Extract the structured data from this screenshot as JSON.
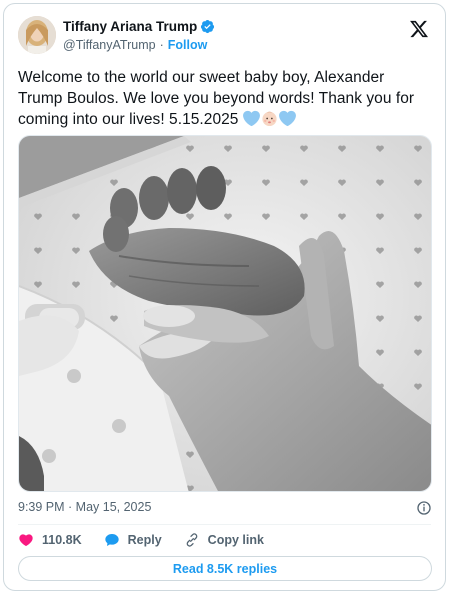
{
  "author": {
    "display_name": "Tiffany Ariana Trump",
    "handle": "@TiffanyATrump",
    "separator": "·",
    "follow_label": "Follow",
    "verified": true
  },
  "tweet": {
    "text": "Welcome to the world our sweet baby boy, Alexander Trump Boulos. We love you beyond words! Thank you for coming into our lives! 5.15.2025",
    "emojis": [
      "blue-heart",
      "baby-face",
      "blue-heart"
    ],
    "media": {
      "description": "black-and-white-photo-baby-foot-in-hand"
    }
  },
  "meta": {
    "timestamp": "9:39 PM · May 15, 2025"
  },
  "actions": {
    "like_count": "110.8K",
    "reply_label": "Reply",
    "copy_link_label": "Copy link"
  },
  "footer": {
    "read_replies_label": "Read 8.5K replies"
  },
  "colors": {
    "accent": "#1d9bf0",
    "like": "#f91880",
    "text": "#0f1419",
    "muted": "#536471"
  }
}
